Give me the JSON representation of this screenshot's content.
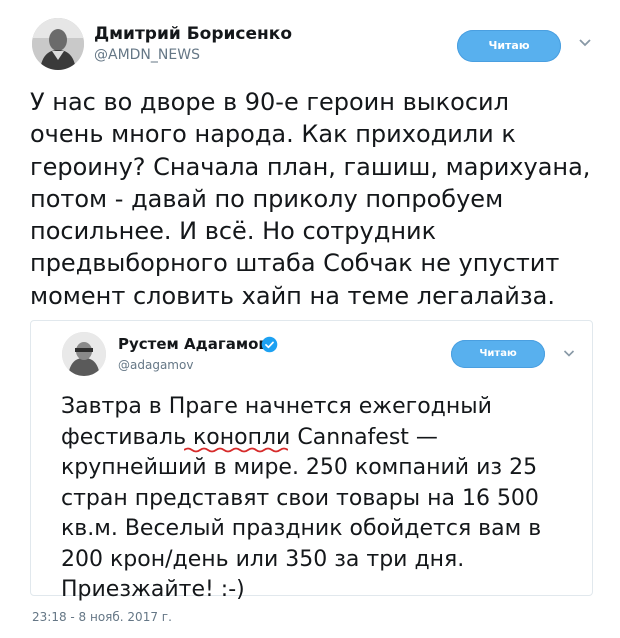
{
  "tweet": {
    "author_name": "Дмитрий Борисенко",
    "author_handle": "@AMDN_NEWS",
    "follow_label": "Читаю",
    "text": "У нас во дворе в 90-е героин выкосил\nочень много народа. Как приходили к\nгероину? Сначала план, гашиш, марихуана,\nпотом - давай по приколу попробуем\nпосильнее. И всё. Но сотрудник\nпредвыборного штаба Собчак не упустит\nмомент словить хайп на теме легалайза.",
    "timestamp": "23:18 - 8 нояб. 2017 г."
  },
  "quoted_tweet": {
    "author_name": "Рустем Адагамов",
    "author_handle": "@adagamov",
    "verified": true,
    "follow_label": "Читаю",
    "text": "Завтра в Праге начнется ежегодный\nфестиваль конопли Cannafest —\nкрупнейший в мире. 250 компаний из 25\nстран представят свои товары на 16 500\nкв.м. Веселый праздник обойдется вам в\n200 крон/день или 350 за три дня.\nПриезжайте! :-)"
  },
  "colors": {
    "follow_button": "#58b0ee",
    "verified_badge": "#1da1f2",
    "spellcheck_underline": "#d62b2b",
    "secondary_text": "#657786"
  },
  "icons": [
    "chevron-down-icon",
    "verified-badge-icon"
  ]
}
